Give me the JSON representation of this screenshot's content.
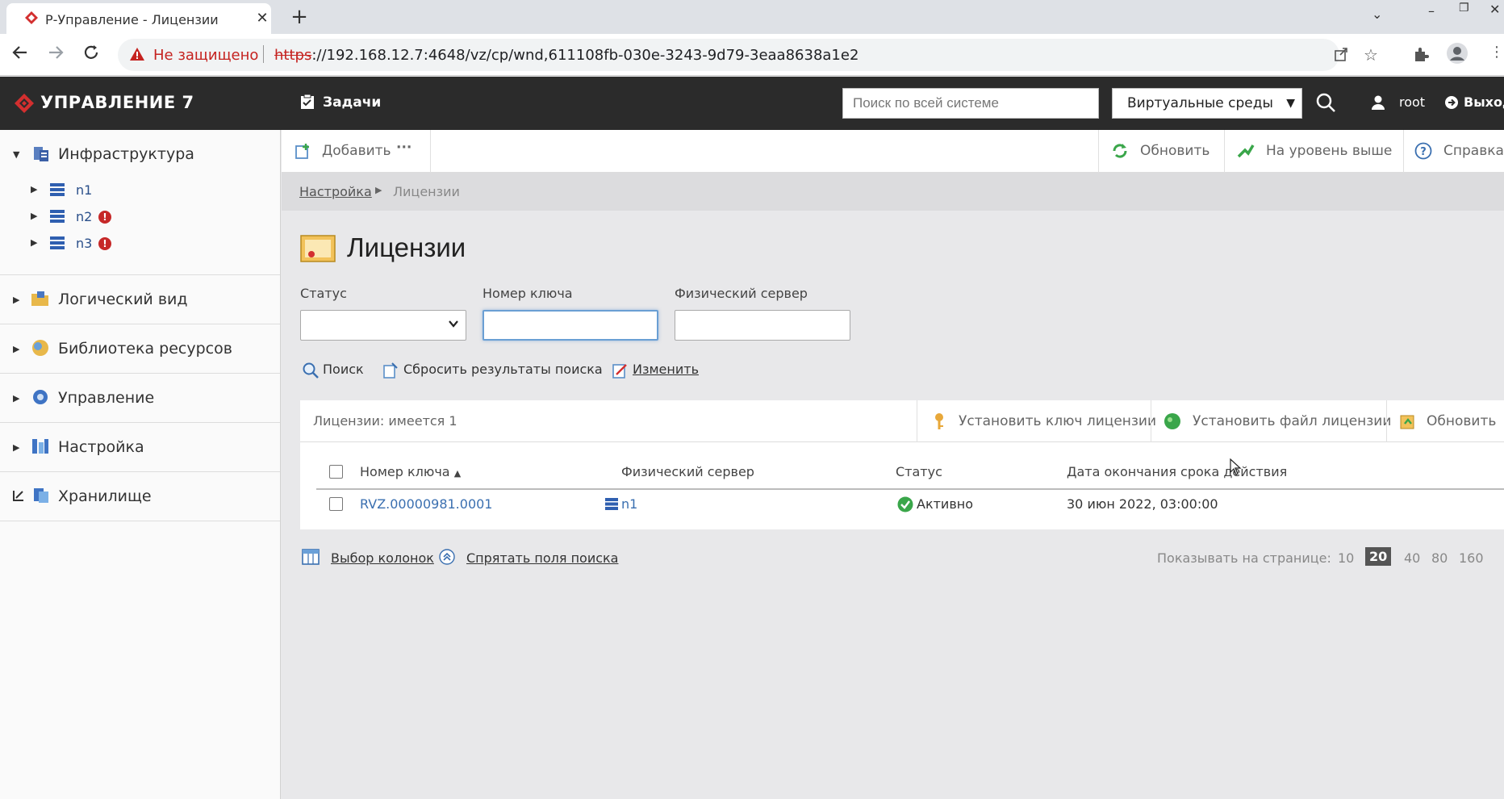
{
  "browser": {
    "tab_title": "Р-Управление - Лицензии",
    "not_secure": "Не защищено",
    "url_scheme": "https",
    "url_rest": "://192.168.12.7:4648/vz/cp/wnd,611108fb-030e-3243-9d79-3eaa8638a1e2"
  },
  "header": {
    "logo": "УПРАВЛЕНИЕ 7",
    "tasks": "Задачи",
    "search_placeholder": "Поиск по всей системе",
    "env_select": "Виртуальные среды",
    "user": "root",
    "logout": "Выход"
  },
  "sidebar": {
    "infra": "Инфраструктура",
    "nodes": [
      {
        "label": "n1",
        "error": false
      },
      {
        "label": "n2",
        "error": true
      },
      {
        "label": "n3",
        "error": true
      }
    ],
    "sections": [
      "Логический вид",
      "Библиотека ресурсов",
      "Управление",
      "Настройка",
      "Хранилище"
    ]
  },
  "toolbar": {
    "add": "Добавить",
    "more": "···",
    "refresh": "Обновить",
    "up_level": "На уровень выше",
    "help": "Справка"
  },
  "breadcrumb": {
    "parent": "Настройка",
    "current": "Лицензии"
  },
  "page": {
    "title": "Лицензии"
  },
  "filters": {
    "status_label": "Статус",
    "status_value": "",
    "key_label": "Номер ключа",
    "key_value": "",
    "server_label": "Физический сервер",
    "server_value": "",
    "search": "Поиск",
    "reset": "Сбросить результаты поиска",
    "change": "Изменить"
  },
  "grid": {
    "count": "Лицензии: имеется 1",
    "install_key": "Установить ключ лицензии",
    "install_file": "Установить файл лицензии",
    "refresh": "Обновить",
    "columns": {
      "key": "Номер ключа",
      "server": "Физический сервер",
      "status": "Статус",
      "expiry": "Дата окончания срока действия"
    },
    "rows": [
      {
        "key": "RVZ.00000981.0001",
        "server": "n1",
        "status": "Активно",
        "expiry": "30 июн 2022, 03:00:00"
      }
    ]
  },
  "footer": {
    "columns_choice": "Выбор колонок",
    "hide_search": "Спрятать поля поиска",
    "per_page_label": "Показывать на странице:",
    "per_page_options": [
      "10",
      "20",
      "40",
      "80",
      "160"
    ],
    "per_page_selected": "20"
  },
  "colors": {
    "header_bg": "#2b2b2b",
    "brand_red": "#d32f2f",
    "link": "#3a6fb0",
    "status_ok": "#3aa64a",
    "error": "#c62828"
  }
}
